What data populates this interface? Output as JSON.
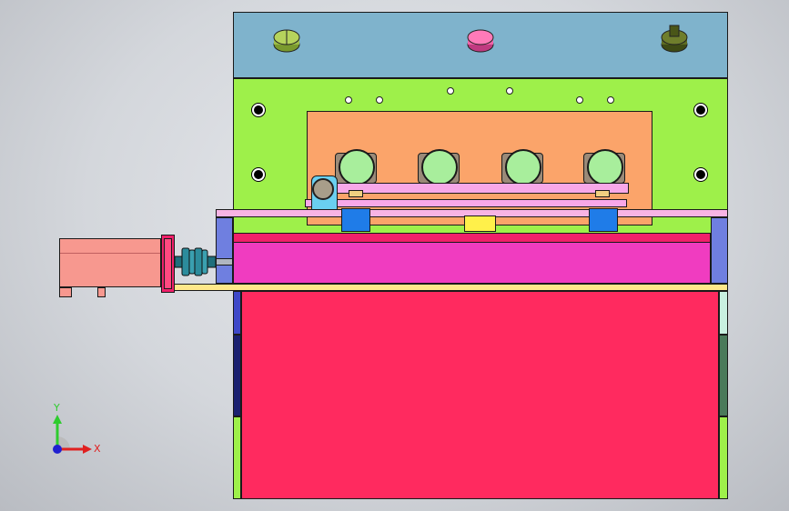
{
  "viewport": {
    "background": "#d4d7dc",
    "parts": {
      "top_plate": {
        "color": "#7fb3cc"
      },
      "main_plate": {
        "color": "#9ef04a"
      },
      "inner_panel": {
        "color": "#fba46a"
      },
      "roller_color": "#a8ee9c",
      "magenta_bar": {
        "color": "#f03cc0"
      },
      "red_block": {
        "color": "#ff2a5f"
      },
      "motor_body": {
        "color": "#f7988f"
      },
      "coupling": {
        "color": "#2c8c9c"
      },
      "side_post": {
        "color": "#6f7fe0"
      }
    },
    "knobs": [
      {
        "icon": "knob-green-icon",
        "color": "#9dbd4a"
      },
      {
        "icon": "knob-pink-icon",
        "color": "#f064a8"
      },
      {
        "icon": "knob-olive-icon",
        "color": "#5d6b22"
      }
    ]
  },
  "triad": {
    "y_label": "Y",
    "x_label": "X",
    "y_color": "#2ecc2e",
    "x_color": "#e02020",
    "z_color": "#2020d0"
  }
}
